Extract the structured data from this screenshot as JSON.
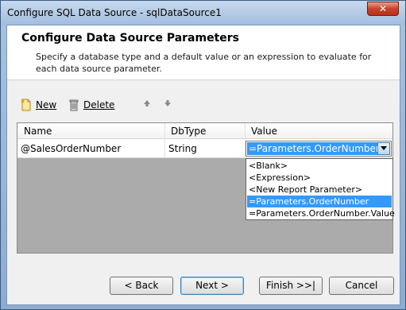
{
  "window": {
    "title": "Configure SQL Data Source - sqlDataSource1",
    "close_glyph": "✕"
  },
  "header": {
    "title": "Configure Data Source Parameters",
    "description": "Specify a database type and a default value or an expression to evaluate for each data source parameter."
  },
  "toolbar": {
    "new_label": "New",
    "delete_label": "Delete"
  },
  "grid": {
    "columns": [
      "Name",
      "DbType",
      "Value"
    ],
    "rows": [
      {
        "name": "@SalesOrderNumber",
        "dbtype": "String",
        "value": "=Parameters.OrderNumber"
      }
    ]
  },
  "dropdown": {
    "options": [
      "<Blank>",
      "<Expression>",
      "<New Report Parameter>",
      "=Parameters.OrderNumber",
      "=Parameters.OrderNumber.Value"
    ],
    "selected": "=Parameters.OrderNumber"
  },
  "buttons": {
    "back": "< Back",
    "next": "Next >",
    "finish": "Finish >>|",
    "cancel": "Cancel"
  },
  "colors": {
    "selection": "#3399ff",
    "grid_background": "#ababab"
  }
}
